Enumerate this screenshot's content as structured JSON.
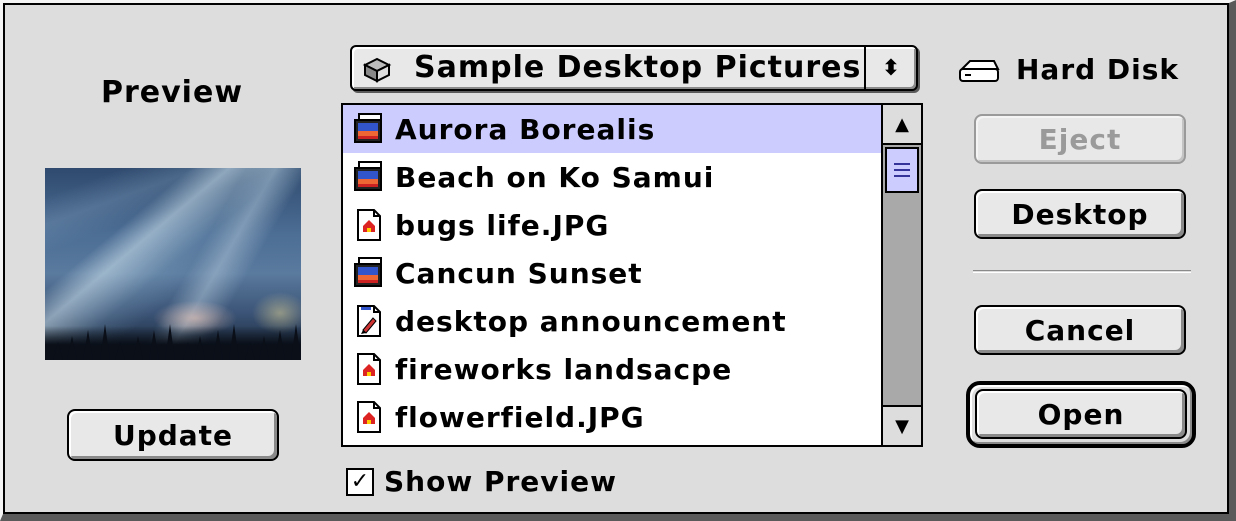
{
  "preview": {
    "label": "Preview",
    "image_icon": "aurora-preview-image",
    "update_label": "Update"
  },
  "popup": {
    "label": "Sample Desktop Pictures",
    "icon": "folder-icon",
    "arrows": "⬍"
  },
  "files": [
    {
      "name": "Aurora Borealis",
      "icon": "picture-document-icon",
      "selected": true
    },
    {
      "name": "Beach on Ko Samui",
      "icon": "picture-document-icon",
      "selected": false
    },
    {
      "name": "bugs life.JPG",
      "icon": "jpeg-document-icon",
      "selected": false
    },
    {
      "name": "Cancun Sunset",
      "icon": "picture-document-icon",
      "selected": false
    },
    {
      "name": "desktop announcement",
      "icon": "text-document-icon",
      "selected": false
    },
    {
      "name": "fireworks landsacpe",
      "icon": "jpeg-document-icon",
      "selected": false
    },
    {
      "name": "flowerfield.JPG",
      "icon": "jpeg-document-icon",
      "selected": false
    }
  ],
  "scrollbar": {
    "up_arrow": "▲",
    "down_arrow": "▼"
  },
  "show_preview": {
    "label": "Show Preview",
    "checked": true,
    "checkmark": "✓"
  },
  "disk": {
    "label": "Hard Disk",
    "icon": "hard-disk-icon"
  },
  "buttons": {
    "eject": "Eject",
    "desktop": "Desktop",
    "cancel": "Cancel",
    "open": "Open"
  },
  "colors": {
    "selection": "#ccccff",
    "dialog_bg": "#dddddd",
    "disabled_text": "#9a9a9a"
  }
}
